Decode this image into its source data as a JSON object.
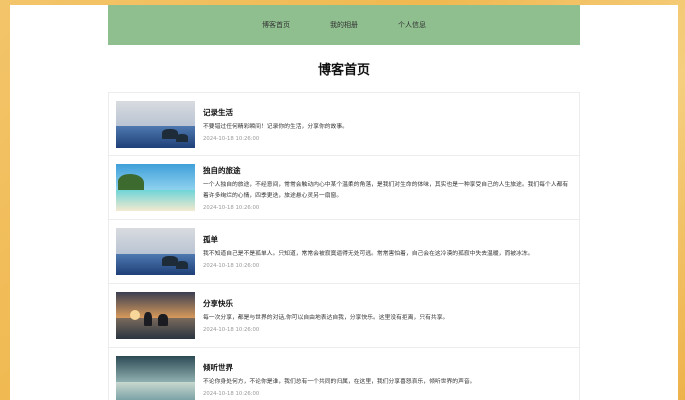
{
  "nav": {
    "items": [
      {
        "label": "博客首页"
      },
      {
        "label": "我的相册"
      },
      {
        "label": "个人信息"
      }
    ]
  },
  "main": {
    "title": "博客首页",
    "posts": [
      {
        "title": "记录生活",
        "excerpt": "不要错过任何精彩瞬间！记录你的生活，分享你的故事。",
        "date": "2024-10-18 10:26:00"
      },
      {
        "title": "独自的旅途",
        "excerpt": "一个人独自的旅途，不经意间，常常会触动内心中某个温柔的角落，是我们对生命的体味，其实也是一种享受自己的人生旅途。我们每个人都有着许多绚烂的心情，四季更迭，旅途悬心灵另一扇窗。",
        "date": "2024-10-18 10:26:00"
      },
      {
        "title": "孤单",
        "excerpt": "我不知道自己是不是孤单人。只知道，常常会被寂寞逼得无处可逃。常常害怕着，自己会在这冷漠的孤寂中失去温暖，而被冰冻。",
        "date": "2024-10-18 10:26:00"
      },
      {
        "title": "分享快乐",
        "excerpt": "每一次分享，都是与世界的对话,你可以自由地表达自我，分享快乐。这里没有拒离，只有共享。",
        "date": "2024-10-18 10:26:00"
      },
      {
        "title": "倾听世界",
        "excerpt": "不论你身处何方，不论你是谁，我们总有一个共同的归属，在这里，我们分享喜怒哀乐，倾听世界的声音。",
        "date": "2024-10-18 10:26:00"
      }
    ]
  }
}
